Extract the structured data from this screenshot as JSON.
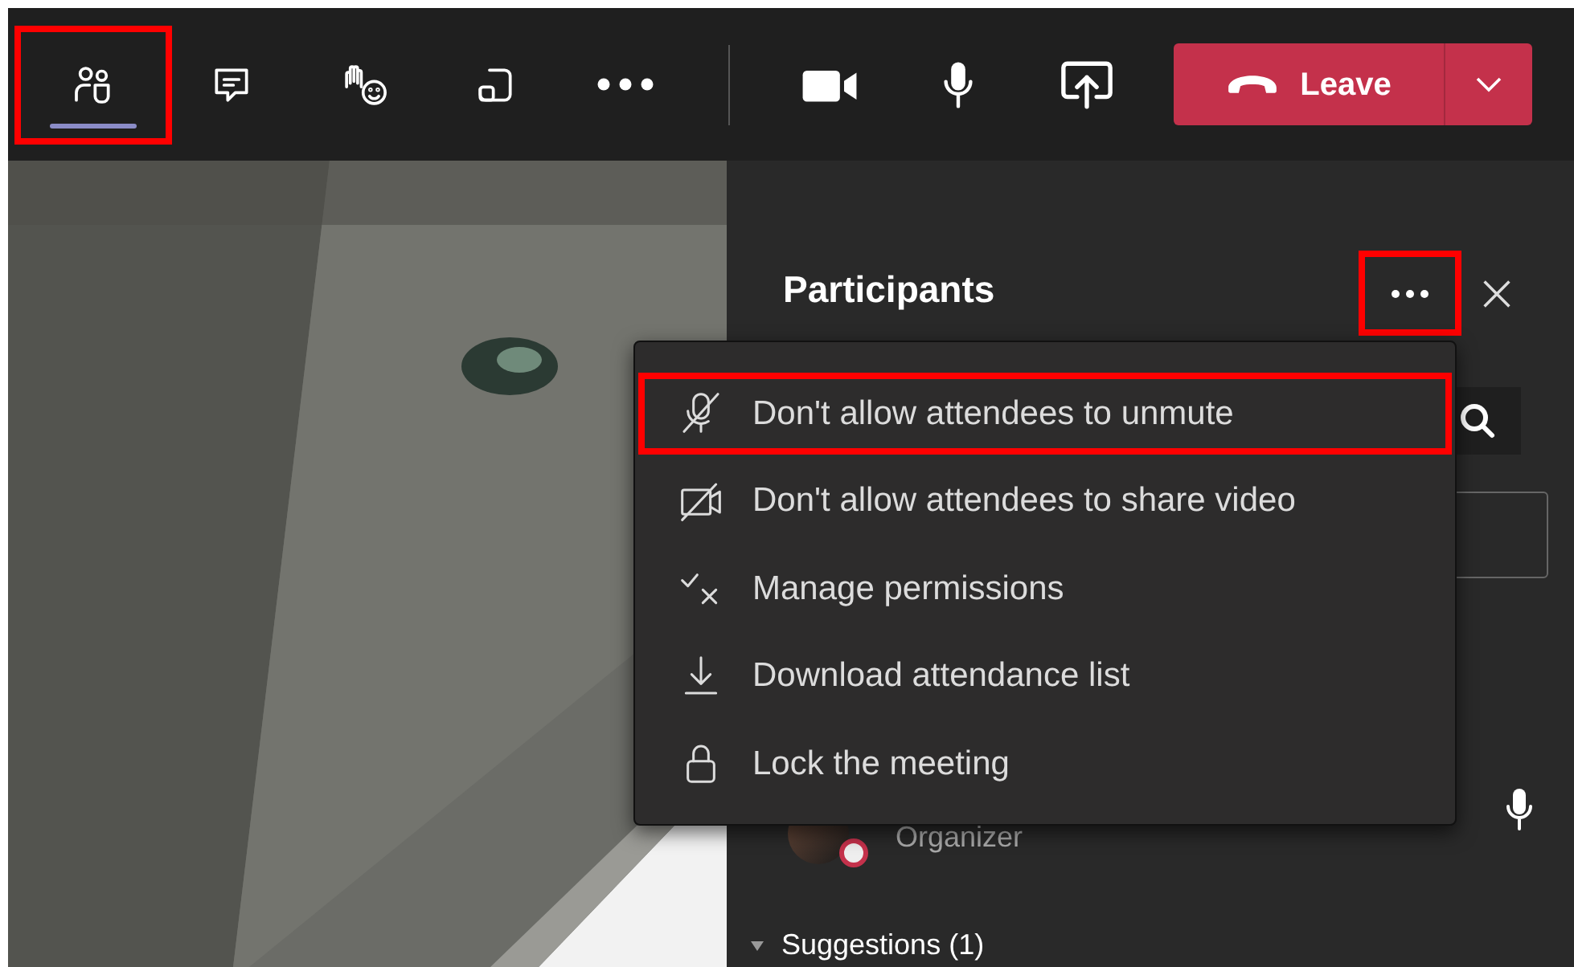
{
  "toolbar": {
    "items": [
      {
        "kind": "people",
        "selected": true,
        "highlighted": true
      },
      {
        "kind": "chat",
        "selected": false,
        "highlighted": false
      },
      {
        "kind": "react",
        "selected": false,
        "highlighted": false
      },
      {
        "kind": "rooms",
        "selected": false,
        "highlighted": false
      },
      {
        "kind": "more",
        "selected": false,
        "highlighted": false
      },
      {
        "kind": "camera",
        "selected": false,
        "highlighted": false
      },
      {
        "kind": "mic",
        "selected": false,
        "highlighted": false
      },
      {
        "kind": "share",
        "selected": false,
        "highlighted": false
      }
    ],
    "leave_button": {
      "label": "Leave"
    }
  },
  "panel": {
    "title": "Participants",
    "more_button": {
      "highlighted": true
    },
    "participant": {
      "role": "Organizer"
    },
    "suggestions": {
      "label": "Suggestions (1)",
      "expanded": true
    }
  },
  "menu": {
    "items": [
      {
        "kind": "mic-off",
        "label": "Don't allow attendees to unmute",
        "highlighted": true
      },
      {
        "kind": "video-off",
        "label": "Don't allow attendees to share video",
        "highlighted": false
      },
      {
        "kind": "permissions",
        "label": "Manage permissions",
        "highlighted": false
      },
      {
        "kind": "download",
        "label": "Download attendance list",
        "highlighted": false
      },
      {
        "kind": "lock",
        "label": "Lock the meeting",
        "highlighted": false
      }
    ]
  }
}
